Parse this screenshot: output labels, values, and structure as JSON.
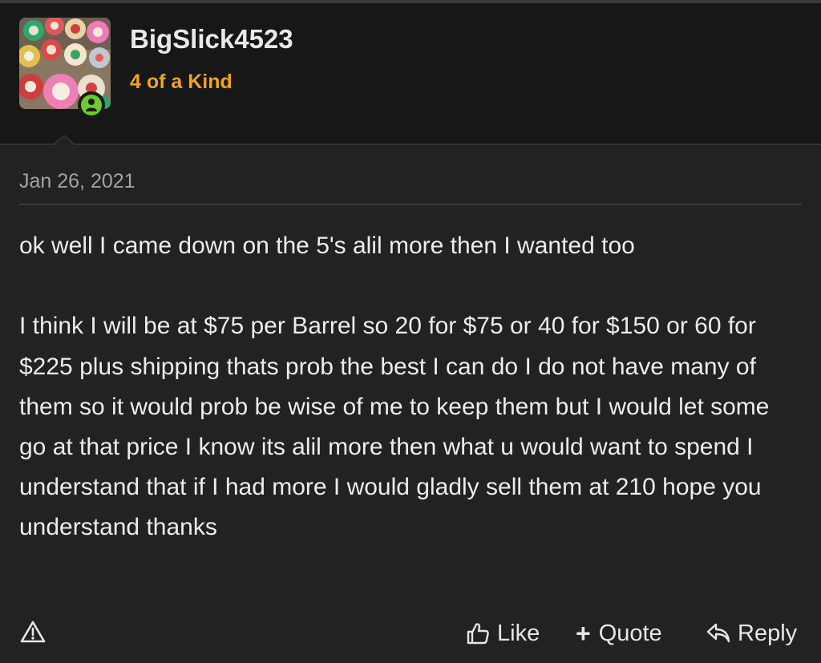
{
  "user": {
    "name": "BigSlick4523",
    "title": "4 of a Kind",
    "avatar_icon": "avatar-poker-chips",
    "status_icon": "online-user-icon"
  },
  "post": {
    "date": "Jan 26, 2021",
    "message": "ok well I came down on the 5's alil more then I wanted too\n\nI think I will be at $75 per Barrel so 20 for $75 or 40 for $150 or 60 for $225 plus shipping thats prob the best I can do I do not have many of them so it would prob be wise of me to keep them but I would let some go at that price I know its alil more then what u would want to spend I understand that if I had more I would gladly sell them at 210 hope you understand thanks"
  },
  "actions": {
    "report_icon": "warning-triangle-icon",
    "like_label": "Like",
    "quote_label": "Quote",
    "reply_label": "Reply"
  },
  "colors": {
    "title_accent": "#f2a41a",
    "online_green": "#6fca2a",
    "header_bg": "#171717",
    "body_bg": "#222222"
  }
}
